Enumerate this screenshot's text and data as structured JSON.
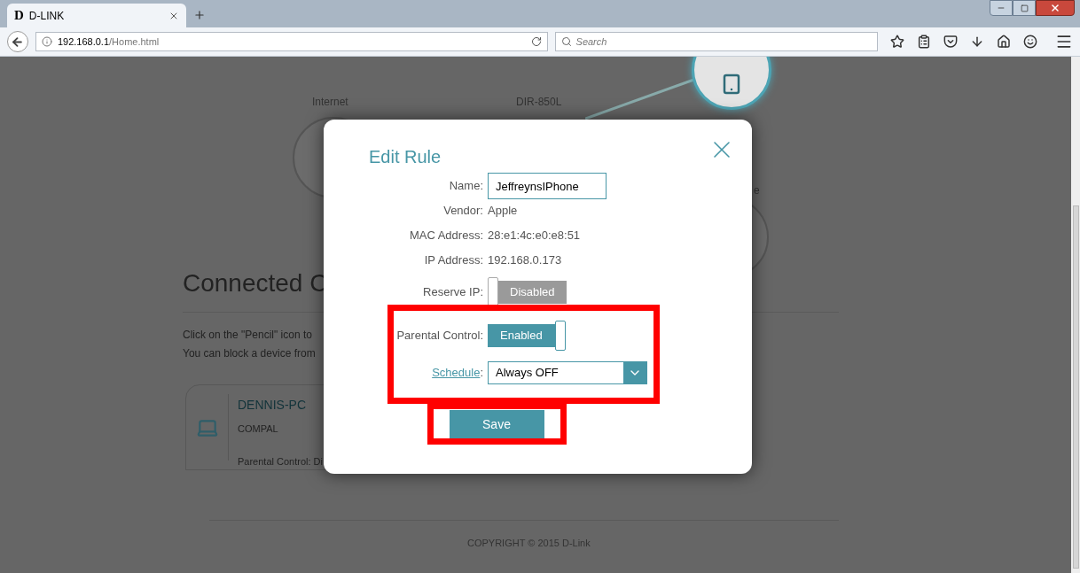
{
  "browser": {
    "tab": {
      "title": "D-LINK",
      "logo": "D"
    },
    "address": {
      "host": "192.168.0.1",
      "path": "/Home.html"
    },
    "search": {
      "placeholder": "Search"
    }
  },
  "page": {
    "diagram": {
      "nodes": [
        {
          "label": "Internet"
        },
        {
          "label": "DIR-850L"
        },
        {
          "label": "e"
        }
      ]
    },
    "heading": "Connected C",
    "instructions": [
      "Click on the \"Pencil\" icon to",
      "You can block a device from"
    ],
    "device_card": {
      "name": "DENNIS-PC",
      "vendor": "COMPAL",
      "status": "Parental Control: Di"
    },
    "footer": "COPYRIGHT © 2015 D-Link"
  },
  "dialog": {
    "title": "Edit Rule",
    "fields": [
      {
        "kind": "input",
        "label": "Name:",
        "value": "JeffreynsIPhone",
        "highlighted": false
      },
      {
        "kind": "text",
        "label": "Vendor:",
        "value": "Apple",
        "highlighted": false
      },
      {
        "kind": "text",
        "label": "MAC Address:",
        "value": "28:e1:4c:e0:e8:51",
        "highlighted": false
      },
      {
        "kind": "text",
        "label": "IP Address:",
        "value": "192.168.0.173",
        "highlighted": false
      },
      {
        "kind": "toggle",
        "label": "Reserve IP:",
        "on": false,
        "value": "Disabled",
        "highlighted": false
      },
      {
        "kind": "toggle",
        "label": "Parental Control:",
        "on": true,
        "value": "Enabled",
        "highlighted": true
      },
      {
        "kind": "select",
        "label": "Schedule",
        "suffix": ":",
        "value": "Always OFF",
        "highlighted": true
      }
    ],
    "save": {
      "label": "Save",
      "highlighted": true
    }
  }
}
